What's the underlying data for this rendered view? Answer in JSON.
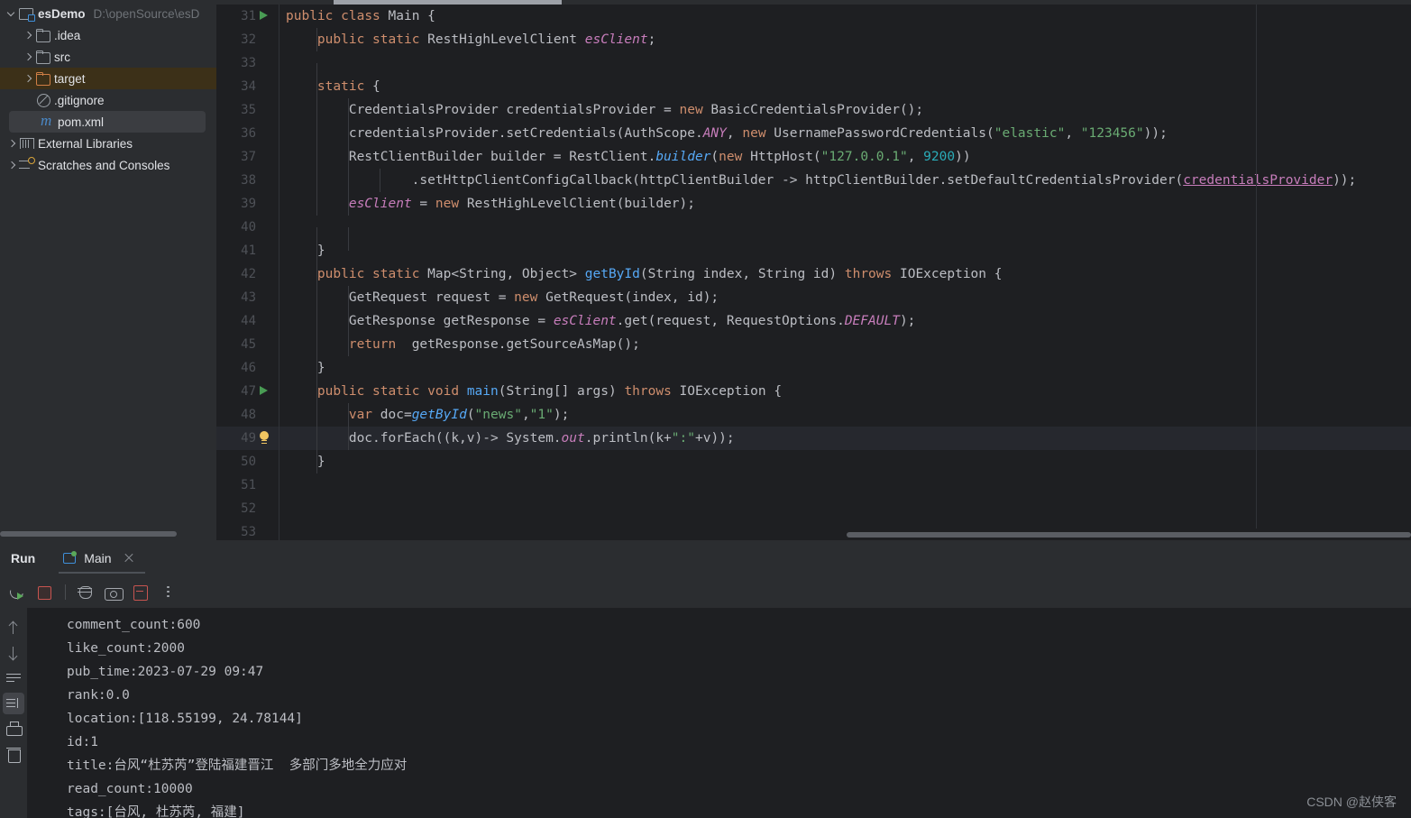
{
  "sidebar": {
    "items": [
      {
        "label": "esDemo",
        "path": "D:\\openSource\\esD",
        "icon": "module-icon",
        "indent": 0,
        "twisty": "open",
        "state": "root"
      },
      {
        "label": ".idea",
        "path": "",
        "icon": "folder-icon",
        "indent": 1,
        "twisty": "closed",
        "state": "normal"
      },
      {
        "label": "src",
        "path": "",
        "icon": "folder-icon",
        "indent": 1,
        "twisty": "closed",
        "state": "normal"
      },
      {
        "label": "target",
        "path": "",
        "icon": "folder-orange-icon",
        "indent": 1,
        "twisty": "closed",
        "state": "highlighted"
      },
      {
        "label": ".gitignore",
        "path": "",
        "icon": "gitignore-icon",
        "indent": 1,
        "twisty": "none",
        "state": "normal"
      },
      {
        "label": "pom.xml",
        "path": "",
        "icon": "maven-icon",
        "indent": 1,
        "twisty": "none",
        "state": "selected"
      },
      {
        "label": "External Libraries",
        "path": "",
        "icon": "library-icon",
        "indent": 0,
        "twisty": "closed",
        "state": "normal"
      },
      {
        "label": "Scratches and Consoles",
        "path": "",
        "icon": "scratches-icon",
        "indent": 0,
        "twisty": "closed",
        "state": "normal"
      }
    ]
  },
  "editor": {
    "lines": [
      {
        "num": "31",
        "marker": "run",
        "caret": false,
        "guides": [],
        "tokens": [
          {
            "t": "kw",
            "v": "public"
          },
          {
            "t": "pln",
            "v": " "
          },
          {
            "t": "kw",
            "v": "class"
          },
          {
            "t": "pln",
            "v": " Main {"
          }
        ]
      },
      {
        "num": "32",
        "marker": "",
        "caret": false,
        "guides": [
          0
        ],
        "tokens": [
          {
            "t": "pln",
            "v": "    "
          },
          {
            "t": "kw",
            "v": "public"
          },
          {
            "t": "pln",
            "v": " "
          },
          {
            "t": "kw",
            "v": "static"
          },
          {
            "t": "pln",
            "v": " RestHighLevelClient "
          },
          {
            "t": "fld",
            "v": "esClient"
          },
          {
            "t": "pln",
            "v": ";"
          }
        ]
      },
      {
        "num": "33",
        "marker": "",
        "caret": false,
        "guides": [
          0
        ],
        "tokens": [
          {
            "t": "pln",
            "v": ""
          }
        ]
      },
      {
        "num": "34",
        "marker": "",
        "caret": false,
        "guides": [
          0
        ],
        "tokens": [
          {
            "t": "pln",
            "v": "    "
          },
          {
            "t": "kw",
            "v": "static"
          },
          {
            "t": "pln",
            "v": " {"
          }
        ]
      },
      {
        "num": "35",
        "marker": "",
        "caret": false,
        "guides": [
          0,
          1
        ],
        "tokens": [
          {
            "t": "pln",
            "v": "        CredentialsProvider credentialsProvider = "
          },
          {
            "t": "kw",
            "v": "new"
          },
          {
            "t": "pln",
            "v": " BasicCredentialsProvider();"
          }
        ]
      },
      {
        "num": "36",
        "marker": "",
        "caret": false,
        "guides": [
          0,
          1
        ],
        "tokens": [
          {
            "t": "pln",
            "v": "        credentialsProvider.setCredentials(AuthScope."
          },
          {
            "t": "stc",
            "v": "ANY"
          },
          {
            "t": "pln",
            "v": ", "
          },
          {
            "t": "kw",
            "v": "new"
          },
          {
            "t": "pln",
            "v": " UsernamePasswordCredentials("
          },
          {
            "t": "str",
            "v": "\"elastic\""
          },
          {
            "t": "pln",
            "v": ", "
          },
          {
            "t": "str",
            "v": "\"123456\""
          },
          {
            "t": "pln",
            "v": "));"
          }
        ]
      },
      {
        "num": "37",
        "marker": "",
        "caret": false,
        "guides": [
          0,
          1
        ],
        "tokens": [
          {
            "t": "pln",
            "v": "        RestClientBuilder builder = RestClient."
          },
          {
            "t": "mthi",
            "v": "builder"
          },
          {
            "t": "pln",
            "v": "("
          },
          {
            "t": "kw",
            "v": "new"
          },
          {
            "t": "pln",
            "v": " HttpHost("
          },
          {
            "t": "str",
            "v": "\"127.0.0.1\""
          },
          {
            "t": "pln",
            "v": ", "
          },
          {
            "t": "num",
            "v": "9200"
          },
          {
            "t": "pln",
            "v": "))"
          }
        ]
      },
      {
        "num": "38",
        "marker": "",
        "caret": false,
        "guides": [
          0,
          1,
          2
        ],
        "tokens": [
          {
            "t": "pln",
            "v": "                .setHttpClientConfigCallback(httpClientBuilder -> httpClientBuilder.setDefaultCredentialsProvider("
          },
          {
            "t": "lnk",
            "v": "credentialsProvider"
          },
          {
            "t": "pln",
            "v": "));"
          }
        ]
      },
      {
        "num": "39",
        "marker": "",
        "caret": false,
        "guides": [
          0,
          1
        ],
        "tokens": [
          {
            "t": "pln",
            "v": "        "
          },
          {
            "t": "fld",
            "v": "esClient"
          },
          {
            "t": "pln",
            "v": " = "
          },
          {
            "t": "kw",
            "v": "new"
          },
          {
            "t": "pln",
            "v": " RestHighLevelClient(builder);"
          }
        ]
      },
      {
        "num": "40",
        "marker": "",
        "caret": false,
        "guides": [
          0,
          1
        ],
        "tokens": [
          {
            "t": "pln",
            "v": ""
          }
        ]
      },
      {
        "num": "41",
        "marker": "",
        "caret": false,
        "guides": [
          0
        ],
        "tokens": [
          {
            "t": "pln",
            "v": "    }"
          }
        ]
      },
      {
        "num": "42",
        "marker": "",
        "caret": false,
        "guides": [
          0
        ],
        "tokens": [
          {
            "t": "pln",
            "v": "    "
          },
          {
            "t": "kw",
            "v": "public"
          },
          {
            "t": "pln",
            "v": " "
          },
          {
            "t": "kw",
            "v": "static"
          },
          {
            "t": "pln",
            "v": " Map<String, Object> "
          },
          {
            "t": "mth",
            "v": "getById"
          },
          {
            "t": "pln",
            "v": "(String index, String id) "
          },
          {
            "t": "kw",
            "v": "throws"
          },
          {
            "t": "pln",
            "v": " IOException {"
          }
        ]
      },
      {
        "num": "43",
        "marker": "",
        "caret": false,
        "guides": [
          0,
          1
        ],
        "tokens": [
          {
            "t": "pln",
            "v": "        GetRequest request = "
          },
          {
            "t": "kw",
            "v": "new"
          },
          {
            "t": "pln",
            "v": " GetRequest(index, id);"
          }
        ]
      },
      {
        "num": "44",
        "marker": "",
        "caret": false,
        "guides": [
          0,
          1
        ],
        "tokens": [
          {
            "t": "pln",
            "v": "        GetResponse getResponse = "
          },
          {
            "t": "fld",
            "v": "esClient"
          },
          {
            "t": "pln",
            "v": ".get(request, RequestOptions."
          },
          {
            "t": "stc",
            "v": "DEFAULT"
          },
          {
            "t": "pln",
            "v": ");"
          }
        ]
      },
      {
        "num": "45",
        "marker": "",
        "caret": false,
        "guides": [
          0,
          1
        ],
        "tokens": [
          {
            "t": "pln",
            "v": "        "
          },
          {
            "t": "kw",
            "v": "return"
          },
          {
            "t": "pln",
            "v": "  getResponse.getSourceAsMap();"
          }
        ]
      },
      {
        "num": "46",
        "marker": "",
        "caret": false,
        "guides": [
          0
        ],
        "tokens": [
          {
            "t": "pln",
            "v": "    }"
          }
        ]
      },
      {
        "num": "47",
        "marker": "run",
        "caret": false,
        "guides": [
          0
        ],
        "tokens": [
          {
            "t": "pln",
            "v": "    "
          },
          {
            "t": "kw",
            "v": "public"
          },
          {
            "t": "pln",
            "v": " "
          },
          {
            "t": "kw",
            "v": "static"
          },
          {
            "t": "pln",
            "v": " "
          },
          {
            "t": "kw",
            "v": "void"
          },
          {
            "t": "pln",
            "v": " "
          },
          {
            "t": "mth",
            "v": "main"
          },
          {
            "t": "pln",
            "v": "(String[] args) "
          },
          {
            "t": "kw",
            "v": "throws"
          },
          {
            "t": "pln",
            "v": " IOException {"
          }
        ]
      },
      {
        "num": "48",
        "marker": "",
        "caret": false,
        "guides": [
          0,
          1
        ],
        "tokens": [
          {
            "t": "pln",
            "v": "        "
          },
          {
            "t": "kw",
            "v": "var"
          },
          {
            "t": "pln",
            "v": " doc="
          },
          {
            "t": "mthi",
            "v": "getById"
          },
          {
            "t": "pln",
            "v": "("
          },
          {
            "t": "str",
            "v": "\"news\""
          },
          {
            "t": "pln",
            "v": ","
          },
          {
            "t": "str",
            "v": "\"1\""
          },
          {
            "t": "pln",
            "v": ");"
          }
        ]
      },
      {
        "num": "49",
        "marker": "bulb",
        "caret": true,
        "guides": [
          0,
          1
        ],
        "tokens": [
          {
            "t": "pln",
            "v": "        doc.forEach((k,v)-> System."
          },
          {
            "t": "fld",
            "v": "out"
          },
          {
            "t": "pln",
            "v": ".println(k+"
          },
          {
            "t": "str",
            "v": "\":\""
          },
          {
            "t": "pln",
            "v": "+v));"
          }
        ]
      },
      {
        "num": "50",
        "marker": "",
        "caret": false,
        "guides": [
          0
        ],
        "tokens": [
          {
            "t": "pln",
            "v": "    }"
          }
        ]
      },
      {
        "num": "51",
        "marker": "",
        "caret": false,
        "guides": [],
        "tokens": [
          {
            "t": "pln",
            "v": ""
          }
        ]
      },
      {
        "num": "52",
        "marker": "",
        "caret": false,
        "guides": [],
        "tokens": [
          {
            "t": "pln",
            "v": ""
          }
        ]
      },
      {
        "num": "53",
        "marker": "",
        "caret": false,
        "guides": [],
        "tokens": [
          {
            "t": "pln",
            "v": ""
          }
        ]
      }
    ]
  },
  "run_panel": {
    "title": "Run",
    "tab_label": "Main",
    "toolbar": [
      {
        "name": "rerun-button",
        "icon": "rerun-icon"
      },
      {
        "name": "stop-button",
        "icon": "stop-icon"
      },
      {
        "name": "debug-button",
        "icon": "bug-icon"
      },
      {
        "name": "screenshot-button",
        "icon": "camera-icon"
      },
      {
        "name": "export-button",
        "icon": "export-icon"
      },
      {
        "name": "more-options-button",
        "icon": "kebab-icon"
      }
    ],
    "side_toolbar": [
      {
        "name": "scroll-up-button",
        "icon": "arrow-up-icon",
        "active": false
      },
      {
        "name": "scroll-down-button",
        "icon": "arrow-down-icon",
        "active": false
      },
      {
        "name": "soft-wrap-button",
        "icon": "soft-wrap-icon",
        "active": false
      },
      {
        "name": "scroll-to-end-button",
        "icon": "scroll-to-end-icon",
        "active": true
      },
      {
        "name": "print-button",
        "icon": "printer-icon",
        "active": false
      },
      {
        "name": "clear-all-button",
        "icon": "trash-icon",
        "active": false
      }
    ],
    "console_lines": [
      "comment_count:600",
      "like_count:2000",
      "pub_time:2023-07-29 09:47",
      "rank:0.0",
      "location:[118.55199, 24.78144]",
      "id:1",
      "title:台风“杜苏芮”登陆福建晋江  多部门多地全力应对",
      "read_count:10000",
      "tags:[台风, 杜苏芮, 福建]"
    ]
  },
  "watermark": "CSDN @赵侠客"
}
